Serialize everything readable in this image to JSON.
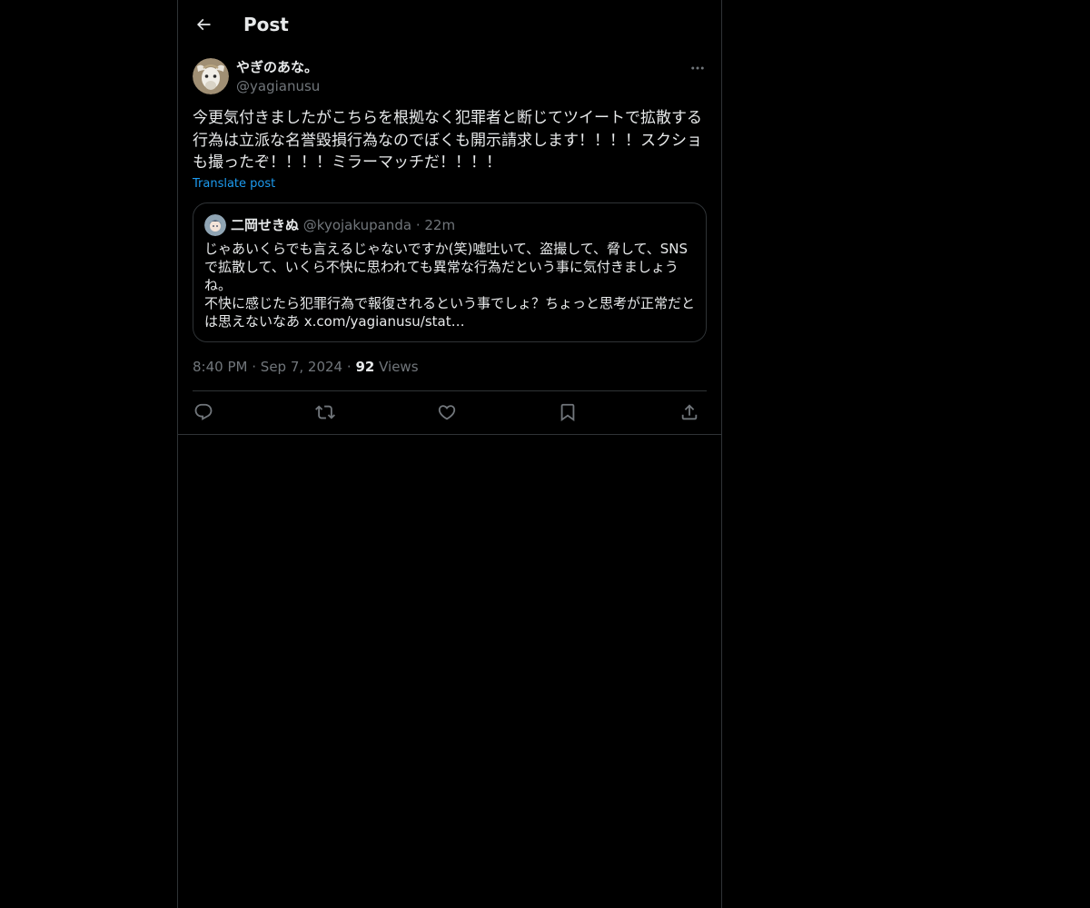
{
  "header": {
    "title": "Post",
    "back_icon": "arrow-left-icon"
  },
  "author": {
    "display_name": "やぎのあな。",
    "handle": "@yagianusu"
  },
  "post": {
    "text": "今更気付きましたがこちらを根拠なく犯罪者と断じてツイートで拡散する\n行為は立派な名誉毀損行為なのでぼくも開示請求します！！！！スクショ\nも撮ったぞ！！！！ミラーマッチだ！！！！",
    "translate_label": "Translate post"
  },
  "quote": {
    "display_name": "二岡せきぬ",
    "handle": "@kyojakupanda",
    "separator": "·",
    "time": "22m",
    "text": "じゃあいくらでも言えるじゃないですか(笑)嘘吐いて、盗撮して、脅して、SNS\nで拡散して、いくら不快に思われても異常な行為だという事に気付きましょう\nね。\n不快に感じたら犯罪行為で報復されるという事でしょ？ちょっと思考が正常だと\nは思えないなあ x.com/yagianusu/stat…"
  },
  "meta": {
    "time": "8:40 PM",
    "separator": "·",
    "date": "Sep 7, 2024",
    "views_count": "92",
    "views_label": "Views"
  },
  "actions": {
    "reply_icon": "reply-icon",
    "repost_icon": "repost-icon",
    "like_icon": "heart-icon",
    "bookmark_icon": "bookmark-icon",
    "share_icon": "share-icon"
  },
  "colors": {
    "background": "#000000",
    "text": "#e7e9ea",
    "secondary": "#71767b",
    "link": "#1d9bf0",
    "border": "#2f3336"
  }
}
